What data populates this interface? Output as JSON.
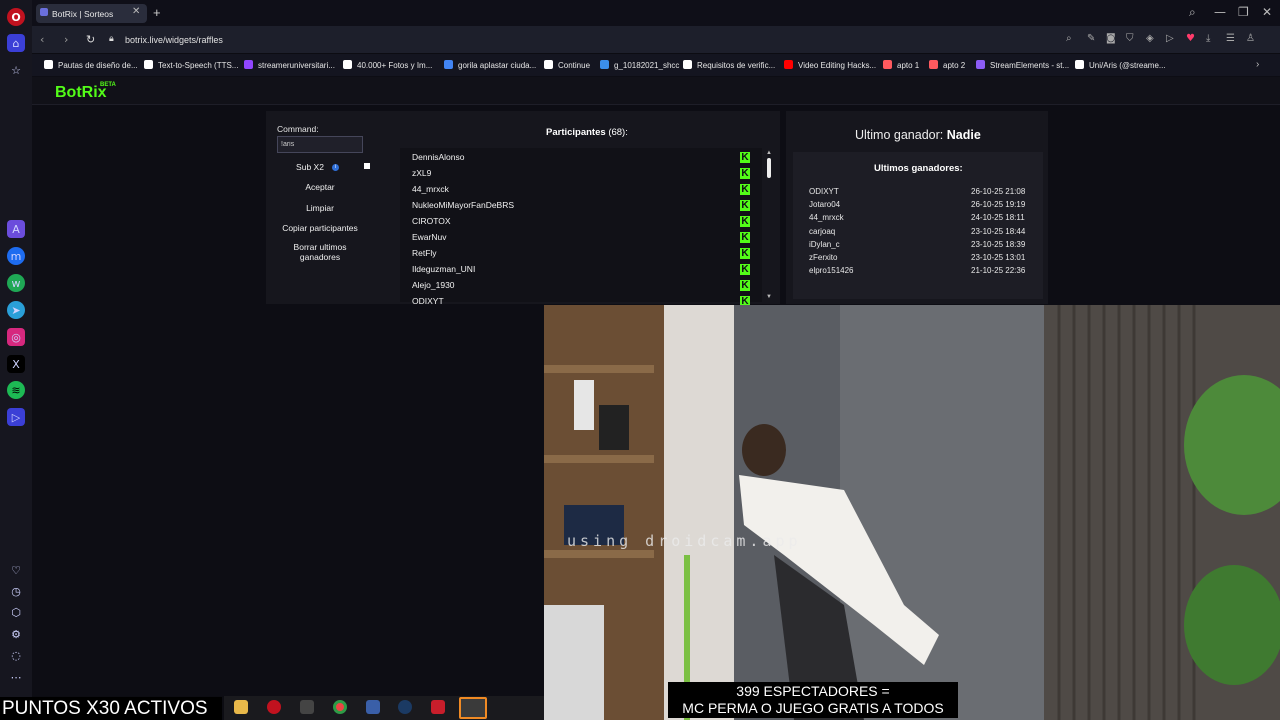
{
  "browser": {
    "tab_title": "BotRix | Sorteos",
    "tab_close": "✕",
    "new_tab": "+",
    "url": "botrix.live/widgets/raffles"
  },
  "bookmarks": [
    {
      "label": "Pautas de diseño de...",
      "color": "#ffffff"
    },
    {
      "label": "Text-to-Speech (TTS...",
      "color": "#ffffff"
    },
    {
      "label": "streameruniversitari...",
      "color": "#9146ff"
    },
    {
      "label": "40.000+ Fotos y Im...",
      "color": "#ffffff"
    },
    {
      "label": "gorila aplastar ciuda...",
      "color": "#4285f4"
    },
    {
      "label": "Continue",
      "color": "#ffffff"
    },
    {
      "label": "g_10182021_shcc",
      "color": "#3b8eea"
    },
    {
      "label": "Requisitos de verific...",
      "color": "#ffffff"
    },
    {
      "label": "Video Editing Hacks...",
      "color": "#ff0000"
    },
    {
      "label": "apto 1",
      "color": "#ff5a5f"
    },
    {
      "label": "apto 2",
      "color": "#ff5a5f"
    },
    {
      "label": "StreamElements - st...",
      "color": "#8c5cf6"
    },
    {
      "label": "Uni/Aris (@streame...",
      "color": "#ffffff"
    }
  ],
  "botrix": {
    "logo": "BotRix",
    "beta": "BETA",
    "command_label": "Command:",
    "command_value": "!aris",
    "buttons": {
      "sub": "Sub X2",
      "accept": "Aceptar",
      "clear": "Limpiar",
      "copy": "Copiar participantes",
      "delete_line1": "Borrar ultimos",
      "delete_line2": "ganadores"
    },
    "participants_title": "Participantes",
    "participants_count": "(68):",
    "participants": [
      "DennisAlonso",
      "zXL9",
      "44_mrxck",
      "NukleoMiMayorFanDeBRS",
      "CIROTOX",
      "EwarNuv",
      "RetFly",
      "Ildeguzman_UNI",
      "Alejo_1930",
      "ODIXYT"
    ],
    "last_winner_label": "Ultimo ganador:",
    "last_winner_value": "Nadie",
    "recent_title": "Ultimos ganadores:",
    "recent": [
      {
        "name": "ODIXYT",
        "date": "26-10-25 21:08"
      },
      {
        "name": "Jotaro04",
        "date": "26-10-25 19:19"
      },
      {
        "name": "44_mrxck",
        "date": "24-10-25 18:11"
      },
      {
        "name": "carjoaq",
        "date": "23-10-25 18:44"
      },
      {
        "name": "iDylan_c",
        "date": "23-10-25 18:39"
      },
      {
        "name": "zFerxito",
        "date": "23-10-25 13:01"
      },
      {
        "name": "elpro151426",
        "date": "21-10-25 22:36"
      }
    ]
  },
  "overlay": {
    "watermark": "using droidcam.app",
    "caption_line1": "399 ESPECTADORES =",
    "caption_line2": "MC PERMA O JUEGO GRATIS A TODOS",
    "puntos": "PUNTOS X30 ACTIVOS"
  },
  "icons": {
    "kick": "K",
    "info": "i"
  }
}
